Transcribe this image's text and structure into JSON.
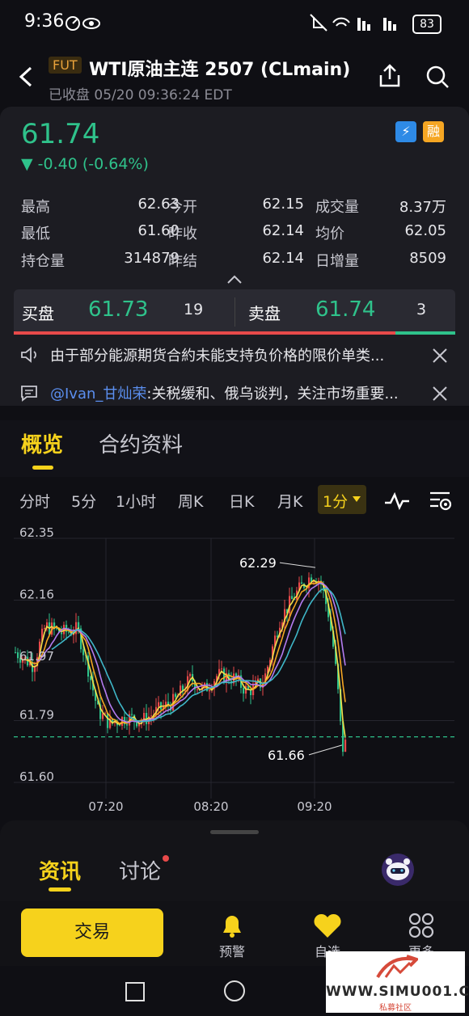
{
  "status_bar": {
    "time": "9:36",
    "battery": "83"
  },
  "header": {
    "badge": "FUT",
    "title": "WTI原油主连 2507 (CLmain)",
    "subtitle": "已收盘 05/20 09:36:24 EDT"
  },
  "quote": {
    "price": "61.74",
    "change": "▼ -0.40 (-0.64%)",
    "badge_lightning": "⚡",
    "badge_rong": "融"
  },
  "stats": [
    [
      {
        "label": "最高",
        "value": "62.63"
      },
      {
        "label": "今开",
        "value": "62.15"
      },
      {
        "label": "成交量",
        "value": "8.37万"
      }
    ],
    [
      {
        "label": "最低",
        "value": "61.60"
      },
      {
        "label": "昨收",
        "value": "62.14"
      },
      {
        "label": "均价",
        "value": "62.05"
      }
    ],
    [
      {
        "label": "持仓量",
        "value": "314879"
      },
      {
        "label": "昨结",
        "value": "62.14"
      },
      {
        "label": "日增量",
        "value": "8509"
      }
    ]
  ],
  "order_book": {
    "bid_label": "买盘",
    "bid_price": "61.73",
    "bid_qty": "19",
    "ask_label": "卖盘",
    "ask_price": "61.74",
    "ask_qty": "3"
  },
  "notices": [
    {
      "text": "由于部分能源期货合約未能支持负价格的限价单类..."
    },
    {
      "mention": "@Ivan_甘灿荣",
      "text": ":关税缓和、俄乌谈判，关注市场重要..."
    }
  ],
  "tabs": [
    "概览",
    "合约资料"
  ],
  "periods": [
    "分时",
    "5分",
    "1小时",
    "周K",
    "日K",
    "月K",
    "1分"
  ],
  "chart_data": {
    "type": "candlestick",
    "y_ticks": [
      "62.35",
      "62.16",
      "61.97",
      "61.79",
      "61.60"
    ],
    "x_ticks": [
      "07:20",
      "08:20",
      "09:20"
    ],
    "ylim": [
      61.6,
      62.35
    ],
    "high_label": "62.29",
    "low_label": "61.66",
    "last_price_line": 61.74
  },
  "bottom_tabs": {
    "news": "资讯",
    "discuss": "讨论"
  },
  "nav": {
    "trade": "交易",
    "alert": "预警",
    "watch": "自选",
    "more": "更多"
  },
  "watermark": {
    "text": "WWW.SIMU001.CN",
    "sub": "私募社区"
  },
  "colors": {
    "up": "#e84a4a",
    "down": "#2fc28b",
    "accent": "#f6d21c"
  }
}
